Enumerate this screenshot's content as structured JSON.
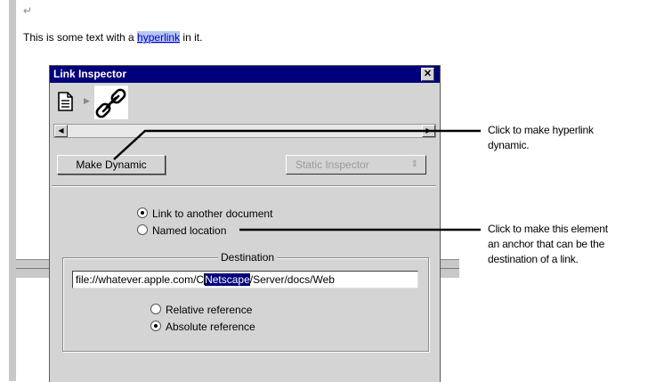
{
  "editor": {
    "return_mark": "↵",
    "text_before": "This is some text with a ",
    "link_text": "hyperlink",
    "text_after": " in it."
  },
  "inspector": {
    "title": "Link Inspector",
    "close_label": "✕",
    "icons": {
      "document": "document-icon",
      "link": "link-icon"
    },
    "make_dynamic_label": "Make Dynamic",
    "static_inspector_label": "Static Inspector",
    "link_another_label": "Link to another document",
    "named_location_label": "Named location",
    "destination_legend": "Destination",
    "destination": {
      "before": "file://whatever.apple.com/C",
      "selected": "Netscape",
      "after": "/Server/docs/Web"
    },
    "relative_label": "Relative reference",
    "absolute_label": "Absolute reference"
  },
  "callouts": {
    "top": [
      "Click to make hyperlink",
      "dynamic."
    ],
    "bottom": [
      "Click to make this element",
      "an anchor that can be the",
      "destination of a link."
    ]
  },
  "colors": {
    "titlebar": "#00007b",
    "panel": "#d4d4d4",
    "link": "#0000cc",
    "selection": "#00007b"
  }
}
